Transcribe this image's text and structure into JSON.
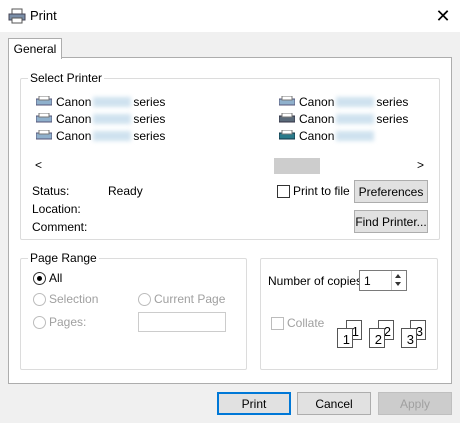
{
  "window": {
    "title": "Print",
    "close_symbol": "✕"
  },
  "tabs": [
    {
      "label": "General"
    }
  ],
  "select_printer": {
    "legend": "Select Printer",
    "printers": [
      {
        "prefix": "Canon",
        "suffix": "series"
      },
      {
        "prefix": "Canon",
        "suffix": "series"
      },
      {
        "prefix": "Canon",
        "suffix": "series"
      },
      {
        "prefix": "Canon",
        "suffix": "series"
      },
      {
        "prefix": "Canon",
        "suffix": "series"
      },
      {
        "prefix": "Canon",
        "suffix": ""
      }
    ],
    "scroll_left": "<",
    "scroll_right": ">",
    "status_label": "Status:",
    "status_value": "Ready",
    "location_label": "Location:",
    "comment_label": "Comment:",
    "print_to_file_label": "Print to file",
    "preferences_label": "Preferences",
    "find_printer_label": "Find Printer..."
  },
  "page_range": {
    "legend": "Page Range",
    "all_label": "All",
    "selection_label": "Selection",
    "current_page_label": "Current Page",
    "pages_label": "Pages:"
  },
  "copies": {
    "label": "Number of copies:",
    "value": "1",
    "collate_label": "Collate",
    "page_numbers": [
      "1",
      "1",
      "2",
      "2",
      "3",
      "3"
    ]
  },
  "buttons": {
    "print": "Print",
    "cancel": "Cancel",
    "apply": "Apply"
  },
  "colors": {
    "accent": "#0078d7",
    "disabled_text": "#a0a0a0"
  }
}
